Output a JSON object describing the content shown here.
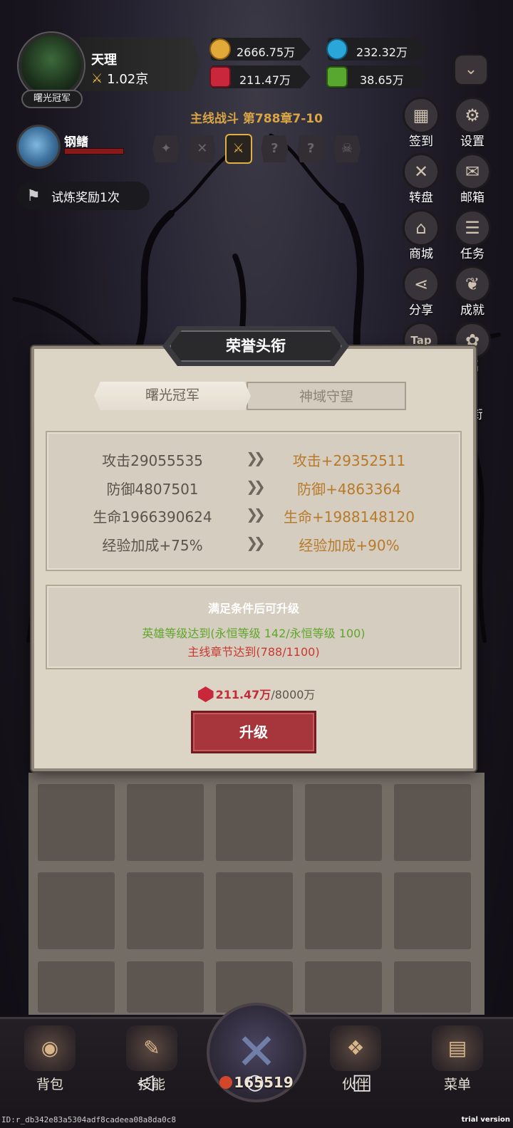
{
  "player": {
    "name": "天理",
    "power": "1.02京",
    "title_badge": "曙光冠军"
  },
  "resources": [
    {
      "name": "gold",
      "value": "2666.75万",
      "color": "#e0a93a"
    },
    {
      "name": "diamond",
      "value": "232.32万",
      "color": "#2aa7d8"
    },
    {
      "name": "ruby",
      "value": "211.47万",
      "color": "#c8283a"
    },
    {
      "name": "ticket",
      "value": "38.65万",
      "color": "#58a830"
    }
  ],
  "battle": {
    "title": "主线战斗 第788章7-10",
    "stages": [
      "✦",
      "✕",
      "⚔",
      "?",
      "?",
      "☠"
    ]
  },
  "pet": {
    "name": "钢鳍"
  },
  "trial": {
    "label": "试炼奖励1次"
  },
  "side_menu": {
    "sign_in": "签到",
    "settings": "设置",
    "wheel": "转盘",
    "mail": "邮箱",
    "shop": "商城",
    "task": "任务",
    "share": "分享",
    "achievement": "成就",
    "tap": "Tap",
    "welfare_partial": "福",
    "partial2": "衔"
  },
  "modal": {
    "title": "荣誉头衔",
    "tabs": [
      "曙光冠军",
      "神域守望"
    ],
    "stats": [
      {
        "current": "攻击29055535",
        "next": "攻击+29352511"
      },
      {
        "current": "防御4807501",
        "next": "防御+4863364"
      },
      {
        "current": "生命1966390624",
        "next": "生命+1988148120"
      },
      {
        "current": "经验加成+75%",
        "next": "经验加成+90%"
      }
    ],
    "arrow": "❯❯",
    "condition_title": "满足条件后可升级",
    "condition_met": "英雄等级达到(永恒等级 142/永恒等级 100)",
    "condition_unmet": "主线章节达到(788/1100)",
    "cost_have": "211.47万",
    "cost_need": "/8000万",
    "upgrade_label": "升级"
  },
  "bottom_nav": {
    "bag": "背包",
    "skills": "技能",
    "gold": "165519",
    "partner": "伙伴",
    "menu": "菜单"
  },
  "watermark": {
    "id": "ID:r_db342e83a5304adf8cadeea08a8da0c8",
    "trial": "trial version"
  }
}
